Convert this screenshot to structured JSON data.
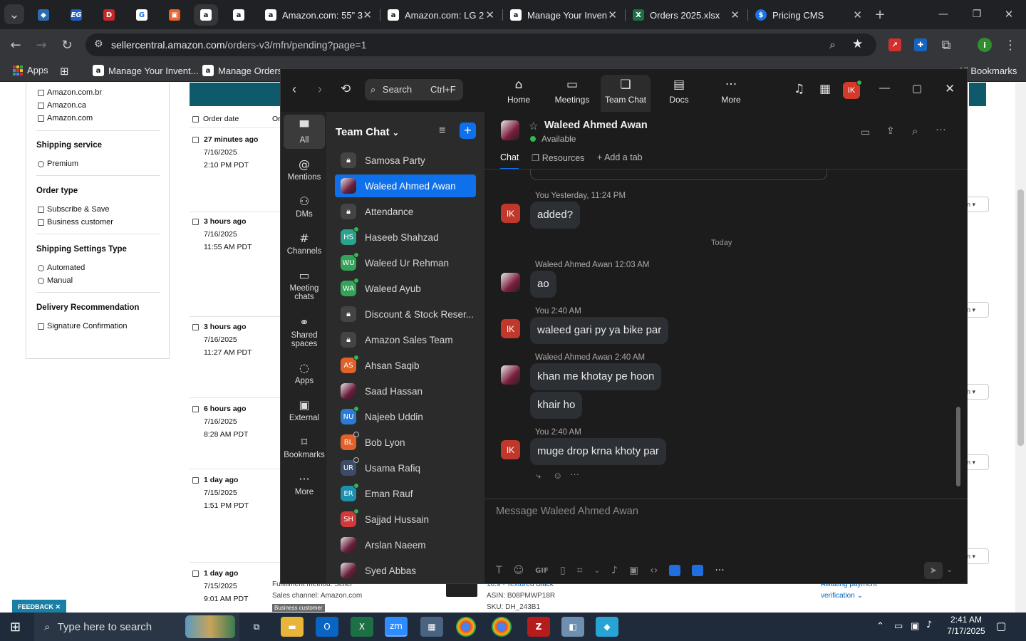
{
  "browser": {
    "tabs": [
      {
        "title": "Amazon.com: 55\" 3",
        "icon": "amazon-icon"
      },
      {
        "title": "Amazon.com: LG 2",
        "icon": "amazon-icon"
      },
      {
        "title": "Manage Your Inven",
        "icon": "amazon-icon"
      },
      {
        "title": "Orders 2025.xlsx",
        "icon": "excel-icon"
      },
      {
        "title": "Pricing CMS",
        "icon": "dollar-icon"
      }
    ],
    "url_host": "sellercentral.amazon.com",
    "url_path": "/orders-v3/mfn/pending?page=1",
    "bookmarks": [
      "Apps",
      "Manage Your Invent...",
      "Manage Orders"
    ],
    "all_bookmarks": "All Bookmarks"
  },
  "seller": {
    "marketplaces": [
      "Amazon.com.br",
      "Amazon.ca",
      "Amazon.com"
    ],
    "shipping_service": {
      "title": "Shipping service",
      "options": [
        "Premium"
      ]
    },
    "order_type": {
      "title": "Order type",
      "options": [
        "Subscribe & Save",
        "Business customer"
      ]
    },
    "shipping_settings": {
      "title": "Shipping Settings Type",
      "options": [
        "Automated",
        "Manual"
      ]
    },
    "delivery": {
      "title": "Delivery Recommendation",
      "options": [
        "Signature Confirmation"
      ]
    },
    "order_date_header": "Order date",
    "order_col_header": "Or",
    "orders": [
      {
        "ago": "27 minutes ago",
        "date": "7/16/2025",
        "time": "2:10 PM PDT"
      },
      {
        "ago": "3 hours ago",
        "date": "7/16/2025",
        "time": "11:55 AM PDT"
      },
      {
        "ago": "3 hours ago",
        "date": "7/16/2025",
        "time": "11:27 AM PDT"
      },
      {
        "ago": "6 hours ago",
        "date": "7/16/2025",
        "time": "8:28 AM PDT"
      },
      {
        "ago": "1 day ago",
        "date": "7/15/2025",
        "time": "1:51 PM PDT"
      },
      {
        "ago": "1 day ago",
        "date": "7/15/2025",
        "time": "9:01 AM PDT"
      }
    ],
    "bottom": {
      "fulfillment": "Fulfillment method: Seller",
      "channel": "Sales channel: Amazon.com",
      "badge": "Business customer",
      "product": "16:9 - Textured Black",
      "asin": "ASIN: B08PMWP18R",
      "sku": "SKU: DH_243B1",
      "status1": "Awaiting payment",
      "status2": "verification"
    },
    "feedback": "FEEDBACK"
  },
  "zoom": {
    "search_label": "Search",
    "search_shortcut": "Ctrl+F",
    "nav": [
      {
        "label": "Home",
        "icon": "home-icon"
      },
      {
        "label": "Meetings",
        "icon": "video-icon"
      },
      {
        "label": "Team Chat",
        "icon": "chat-icon"
      },
      {
        "label": "Docs",
        "icon": "docs-icon"
      },
      {
        "label": "More",
        "icon": "more-icon"
      }
    ],
    "user_initials": "IK",
    "sidebar": [
      "All",
      "Mentions",
      "DMs",
      "Channels",
      "Meeting chats",
      "Shared spaces",
      "Apps",
      "External",
      "Bookmarks",
      "More"
    ],
    "panel_title": "Team Chat",
    "contacts": [
      {
        "name": "Samosa Party",
        "type": "lock"
      },
      {
        "name": "Waleed Ahmed Awan",
        "type": "photo",
        "selected": true
      },
      {
        "name": "Attendance",
        "type": "lock"
      },
      {
        "name": "Haseeb Shahzad",
        "initials": "HS",
        "color": "#2aa38c",
        "status": "#2fb94f"
      },
      {
        "name": "Waleed Ur Rehman",
        "initials": "WU",
        "color": "#33a457",
        "status": "#2fb94f"
      },
      {
        "name": "Waleed Ayub",
        "initials": "WA",
        "color": "#33a457",
        "status": "#2fb94f"
      },
      {
        "name": "Discount & Stock Reser...",
        "type": "lock"
      },
      {
        "name": "Amazon Sales Team",
        "type": "lock"
      },
      {
        "name": "Ahsan Saqib",
        "initials": "AS",
        "color": "#e0612a",
        "status": "#2fb94f"
      },
      {
        "name": "Saad Hassan",
        "type": "photo"
      },
      {
        "name": "Najeeb Uddin",
        "initials": "NU",
        "color": "#2b7bd6",
        "status": "#2fb94f"
      },
      {
        "name": "Bob Lyon",
        "initials": "BL",
        "color": "#e0612a",
        "status": "#2b2b2b"
      },
      {
        "name": "Usama Rafiq",
        "initials": "UR",
        "color": "#3d4c66",
        "status": "#2b2b2b"
      },
      {
        "name": "Eman Rauf",
        "initials": "ER",
        "color": "#1f8fb0",
        "status": "#2fb94f"
      },
      {
        "name": "Sajjad Hussain",
        "initials": "SH",
        "color": "#d23a3a",
        "status": "#2fb94f"
      },
      {
        "name": "Arslan Naeem",
        "type": "photo"
      },
      {
        "name": "Syed Abbas",
        "type": "photo"
      }
    ],
    "chat": {
      "name": "Waleed Ahmed Awan",
      "status": "Available",
      "tabs": [
        "Chat",
        "Resources",
        "Add a tab"
      ],
      "day_divider": "Today",
      "messages": [
        {
          "from": "You",
          "time": "Yesterday, 11:24 PM",
          "text": "added?",
          "me": true
        },
        {
          "from": "Waleed Ahmed Awan",
          "time": "12:03 AM",
          "text": "ao",
          "me": false
        },
        {
          "from": "You",
          "time": "2:40 AM",
          "text": "waleed gari py ya bike par",
          "me": true
        },
        {
          "from": "Waleed Ahmed Awan",
          "time": "2:40 AM",
          "text": "khan me khotay pe hoon",
          "me": false
        },
        {
          "from": "",
          "time": "",
          "text": "khair ho",
          "me": false
        },
        {
          "from": "You",
          "time": "2:40 AM",
          "text": "muge drop krna khoty par",
          "me": true
        }
      ],
      "composer_placeholder": "Message Waleed Ahmed Awan"
    }
  },
  "taskbar": {
    "search_placeholder": "Type here to search",
    "time": "2:41 AM",
    "date": "7/17/2025"
  }
}
